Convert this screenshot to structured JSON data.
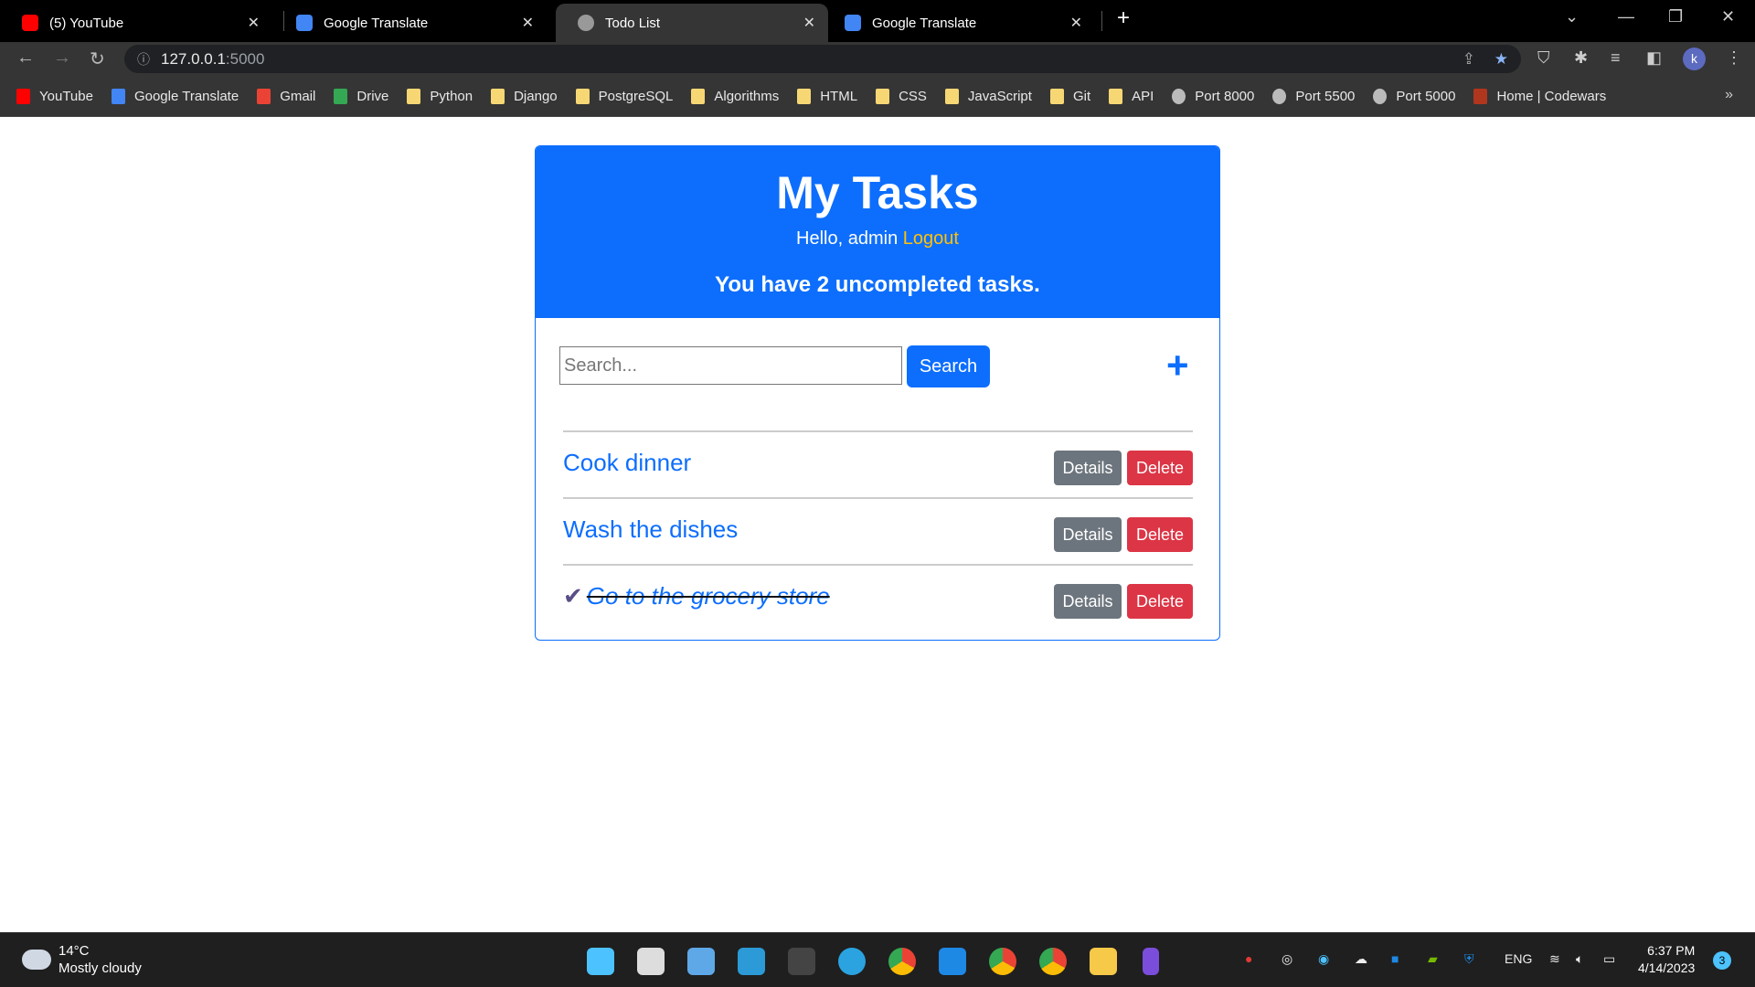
{
  "browser": {
    "tabs": [
      {
        "label": "(5) YouTube",
        "icon": "youtube-icon"
      },
      {
        "label": "Google Translate",
        "icon": "google-translate-icon"
      },
      {
        "label": "Todo List",
        "icon": "globe-icon",
        "active": true
      },
      {
        "label": "Google Translate",
        "icon": "google-translate-icon"
      }
    ],
    "url_host": "127.0.0.1",
    "url_port": ":5000",
    "bookmarks": [
      {
        "label": "YouTube",
        "icon": "youtube",
        "color": "#ff0000"
      },
      {
        "label": "Google Translate",
        "icon": "translate",
        "color": "#4285f4"
      },
      {
        "label": "Gmail",
        "icon": "gmail",
        "color": "#ea4335"
      },
      {
        "label": "Drive",
        "icon": "drive",
        "color": "#34a853"
      },
      {
        "label": "Python",
        "icon": "folder"
      },
      {
        "label": "Django",
        "icon": "folder"
      },
      {
        "label": "PostgreSQL",
        "icon": "folder"
      },
      {
        "label": "Algorithms",
        "icon": "folder"
      },
      {
        "label": "HTML",
        "icon": "folder"
      },
      {
        "label": "CSS",
        "icon": "folder"
      },
      {
        "label": "JavaScript",
        "icon": "folder"
      },
      {
        "label": "Git",
        "icon": "folder"
      },
      {
        "label": "API",
        "icon": "folder"
      },
      {
        "label": "Port 8000",
        "icon": "globe"
      },
      {
        "label": "Port 5500",
        "icon": "globe"
      },
      {
        "label": "Port 5000",
        "icon": "globe"
      },
      {
        "label": "Home | Codewars",
        "icon": "codewars",
        "color": "#b1361e"
      }
    ]
  },
  "page": {
    "title": "My Tasks",
    "greeting": "Hello, admin",
    "logout": "Logout",
    "summary": "You have 2 uncompleted tasks.",
    "search_placeholder": "Search...",
    "search_button": "Search",
    "add_icon": "+",
    "tasks": [
      {
        "title": "Cook dinner",
        "completed": false,
        "details": "Details",
        "delete": "Delete"
      },
      {
        "title": "Wash the dishes",
        "completed": false,
        "details": "Details",
        "delete": "Delete"
      },
      {
        "title": "Go to the grocery store",
        "completed": true,
        "details": "Details",
        "delete": "Delete"
      }
    ],
    "check": "✔"
  },
  "taskbar": {
    "temp": "14°C",
    "weather": "Mostly cloudy",
    "lang": "ENG",
    "time": "6:37 PM",
    "date": "4/14/2023",
    "notifications": "3"
  },
  "colors": {
    "primary": "#0d6efd",
    "danger": "#dc3545",
    "secondary": "#6c757d",
    "warning": "#ffc107"
  }
}
